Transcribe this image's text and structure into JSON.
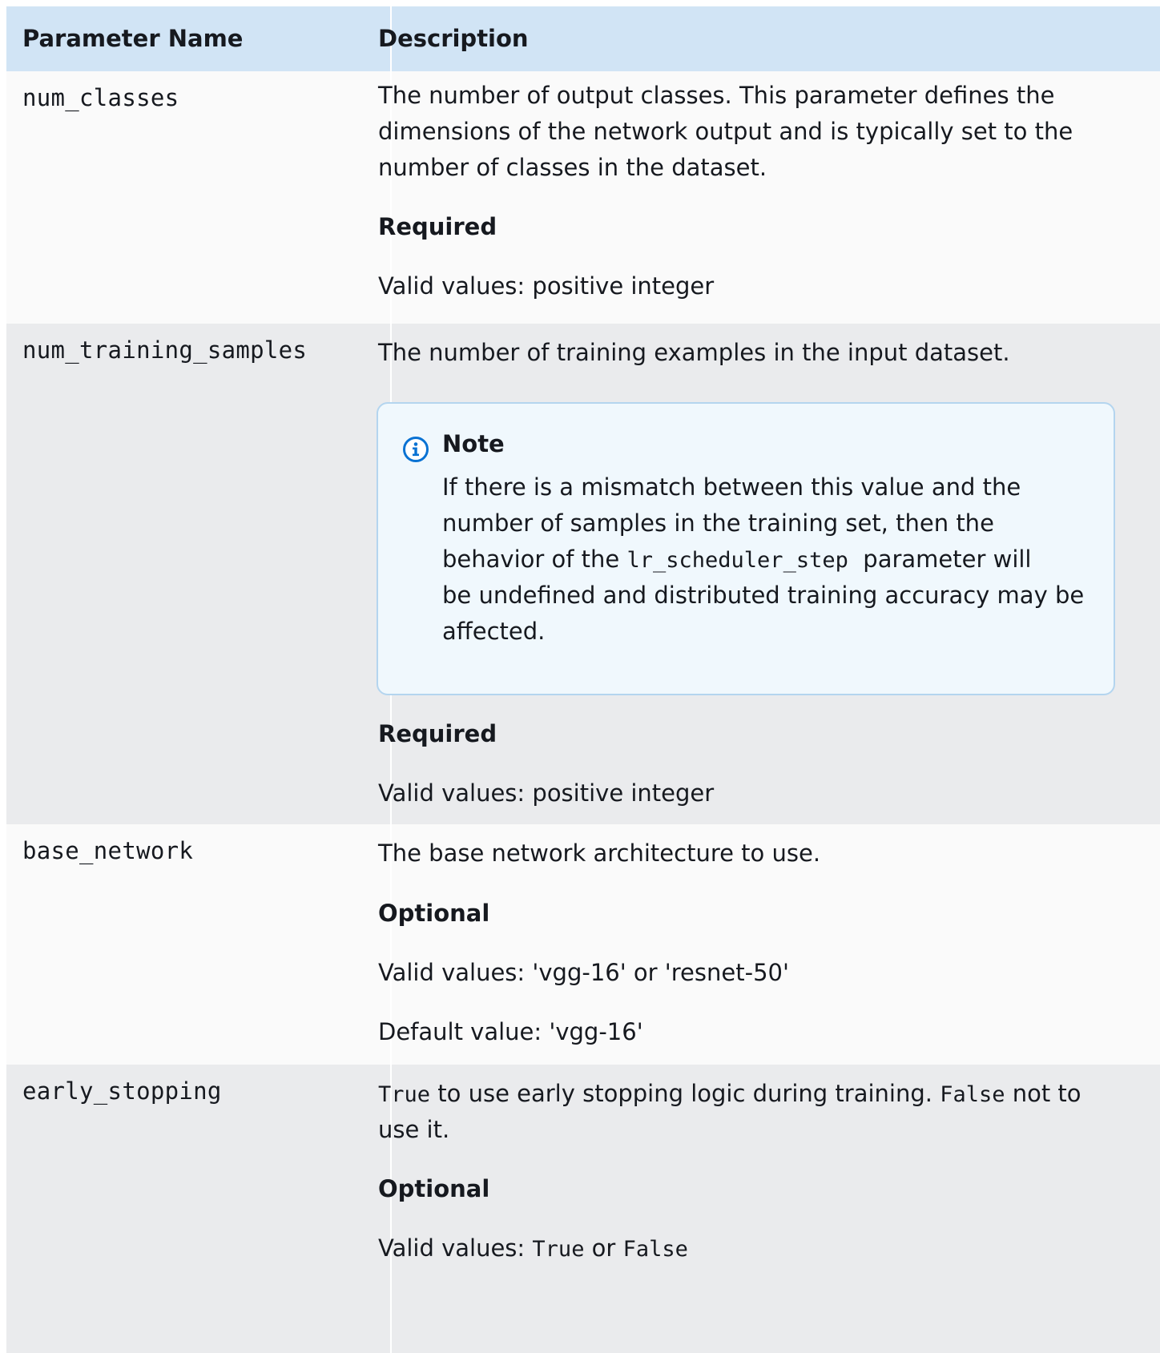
{
  "table": {
    "headers": {
      "name": "Parameter Name",
      "description": "Description"
    },
    "rows": [
      {
        "name": "num_classes",
        "description_lines": [
          "The number of output classes. This parameter defines the",
          "dimensions of the network output and is typically set to the",
          "number of classes in the dataset."
        ],
        "requirement": "Required",
        "valid_values": "Valid values: positive integer"
      },
      {
        "name": "num_training_samples",
        "description": "The number of training examples in the input dataset.",
        "note": {
          "title": "Note",
          "line1": "If there is a mismatch between this value and the",
          "line2": "number of samples in the training set, then the",
          "line3_before": "behavior of the ",
          "line3_code": "lr_scheduler_step",
          "line3_after": " parameter will",
          "line4": "be undefined and distributed training accuracy may be",
          "line5": "affected."
        },
        "requirement": "Required",
        "valid_values": "Valid values: positive integer"
      },
      {
        "name": "base_network",
        "description": "The base network architecture to use.",
        "requirement": "Optional",
        "valid_values": "Valid values: 'vgg-16' or 'resnet-50'",
        "default_value": "Default value: 'vgg-16'"
      },
      {
        "name": "early_stopping",
        "description_code_true": "True",
        "description_mid": " to use early stopping logic during training. ",
        "description_code_false": "False",
        "description_after": " not to",
        "description_line2": "use it.",
        "requirement": "Optional",
        "valid_values_prefix": "Valid values: ",
        "valid_values_true": "True",
        "valid_values_or": " or ",
        "valid_values_false": "False"
      }
    ]
  },
  "colors": {
    "header_bg": "#d1e4f5",
    "row_light": "#fafafa",
    "row_grey": "#eaebed",
    "note_bg": "#f0f8fd",
    "note_border": "#b4d5ef",
    "info_icon": "#0972d3"
  },
  "icons": {
    "note": "info-icon"
  }
}
